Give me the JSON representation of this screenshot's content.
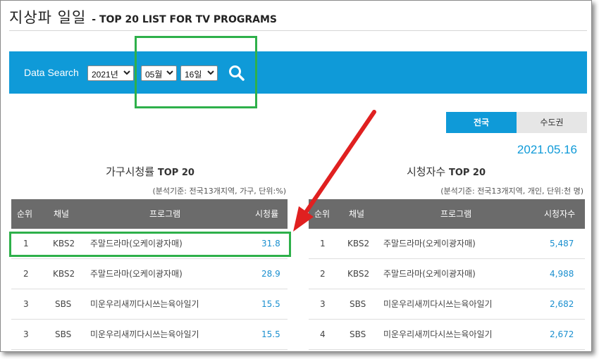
{
  "header": {
    "title_main": "지상파 일일",
    "title_sub": "- TOP 20 LIST FOR TV PROGRAMS"
  },
  "search": {
    "label": "Data Search",
    "year": "2021년",
    "month": "05월",
    "day": "16일"
  },
  "region_tabs": [
    {
      "label": "전국",
      "active": true
    },
    {
      "label": "수도권",
      "active": false
    }
  ],
  "date_display": "2021.05.16",
  "household": {
    "title": "가구시청률",
    "title_en": "TOP 20",
    "note": "(분석기준: 전국13개지역, 가구, 단위:%)",
    "columns": [
      "순위",
      "채널",
      "프로그램",
      "시청률"
    ],
    "rows": [
      {
        "rank": "1",
        "channel": "KBS2",
        "program": "주말드라마(오케이광자매)",
        "value": "31.8"
      },
      {
        "rank": "2",
        "channel": "KBS2",
        "program": "주말드라마(오케이광자매)",
        "value": "28.9"
      },
      {
        "rank": "3",
        "channel": "SBS",
        "program": "미운우리새끼다시쓰는육아일기",
        "value": "15.5"
      },
      {
        "rank": "3",
        "channel": "SBS",
        "program": "미운우리새끼다시쓰는육아일기",
        "value": "15.5"
      }
    ]
  },
  "viewers": {
    "title": "시청자수",
    "title_en": "TOP 20",
    "note": "(분석기준: 전국13개지역, 개인, 단위:천 명)",
    "columns": [
      "순위",
      "채널",
      "프로그램",
      "시청자수"
    ],
    "rows": [
      {
        "rank": "1",
        "channel": "KBS2",
        "program": "주말드라마(오케이광자매)",
        "value": "5,487"
      },
      {
        "rank": "2",
        "channel": "KBS2",
        "program": "주말드라마(오케이광자매)",
        "value": "4,988"
      },
      {
        "rank": "3",
        "channel": "SBS",
        "program": "미운우리새끼다시쓰는육아일기",
        "value": "2,682"
      },
      {
        "rank": "4",
        "channel": "SBS",
        "program": "미운우리새끼다시쓰는육아일기",
        "value": "2,672"
      }
    ]
  },
  "colors": {
    "accent": "#0f9ad8",
    "highlight": "#2eb04a",
    "arrow": "#e02020",
    "table_header": "#6b6b6b"
  }
}
